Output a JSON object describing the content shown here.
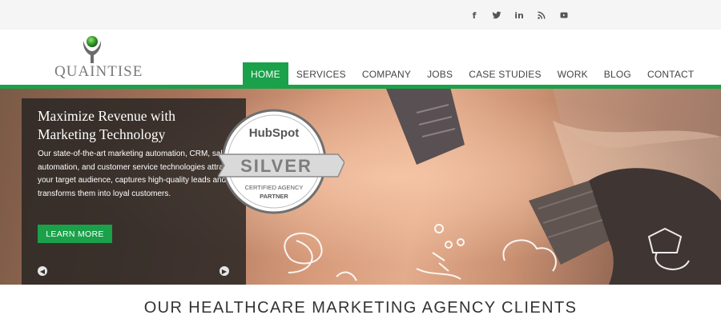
{
  "social": [
    {
      "name": "facebook",
      "glyph": "f"
    },
    {
      "name": "twitter",
      "glyph": ""
    },
    {
      "name": "linkedin",
      "glyph": "in"
    },
    {
      "name": "rss",
      "glyph": ""
    },
    {
      "name": "youtube",
      "glyph": ""
    }
  ],
  "brand": {
    "wordmark": "QUAINTISE",
    "accent": "#1aa14a"
  },
  "nav": {
    "items": [
      "HOME",
      "SERVICES",
      "COMPANY",
      "JOBS",
      "CASE STUDIES",
      "WORK",
      "BLOG",
      "CONTACT"
    ],
    "active": "HOME"
  },
  "hero": {
    "title": "Maximize Revenue with Marketing Technology",
    "body": "Our state-of-the-art marketing automation, CRM, sales automation, and customer service technologies attract your target audience, captures high-quality leads and transforms them into loyal customers.",
    "cta_label": "LEARN MORE",
    "prev_glyph": "◀",
    "next_glyph": "▶"
  },
  "badge": {
    "brand": "HubSpot",
    "tier": "SILVER",
    "line1": "CERTIFIED AGENCY",
    "line2": "PARTNER"
  },
  "section": {
    "title": "OUR HEALTHCARE MARKETING AGENCY CLIENTS"
  }
}
